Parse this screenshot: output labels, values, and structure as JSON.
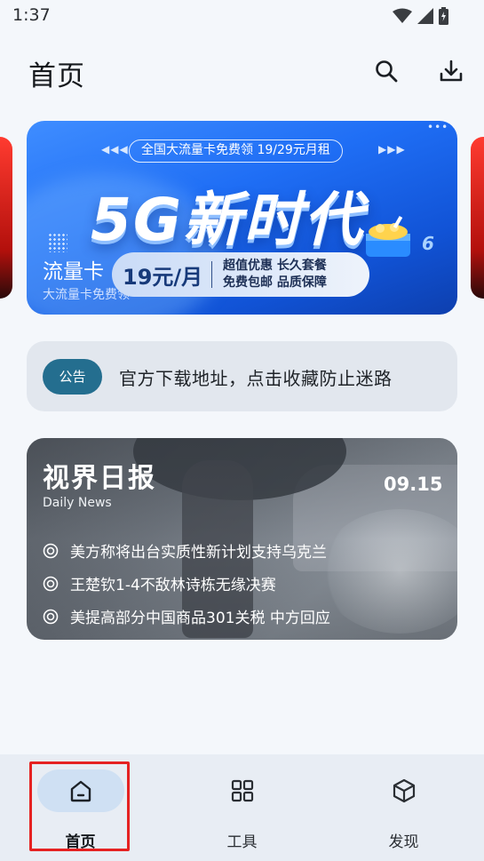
{
  "status_bar": {
    "time": "1:37",
    "icons": [
      "wifi-icon",
      "signal-icon",
      "battery-icon"
    ]
  },
  "header": {
    "title": "首页",
    "search_icon": "search-icon",
    "download_icon": "download-icon"
  },
  "banner": {
    "pill_text": "全国大流量卡免费领 19/29元月租",
    "big_text": "5G新时代",
    "name": "流量卡",
    "sub": "大流量卡免费领",
    "price": "19元/月",
    "features_line1": "超值优惠 长久套餐",
    "features_line2": "免费包邮 品质保障",
    "badge": "6"
  },
  "notice": {
    "badge": "公告",
    "text": "官方下载地址，点击收藏防止迷路"
  },
  "daily_news": {
    "title": "视界日报",
    "subtitle": "Daily News",
    "date": "09.15",
    "items": [
      "美方称将出台实质性新计划支持乌克兰",
      "王楚钦1-4不敌林诗栋无缘决赛",
      "美提高部分中国商品301关税 中方回应"
    ]
  },
  "bottom_nav": {
    "items": [
      {
        "label": "首页",
        "icon": "home-icon",
        "active": true
      },
      {
        "label": "工具",
        "icon": "grid-icon",
        "active": false
      },
      {
        "label": "发现",
        "icon": "cube-icon",
        "active": false
      }
    ]
  },
  "colors": {
    "accent": "#246e8f",
    "nav_active_pill": "#cfe0f3",
    "highlight": "#e52222"
  }
}
